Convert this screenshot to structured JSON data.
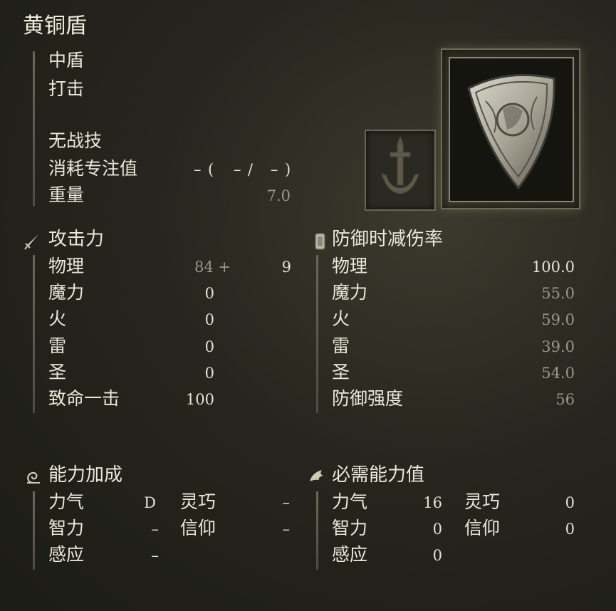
{
  "item": {
    "name": "黄铜盾",
    "type": "中盾",
    "attack_type": "打击",
    "skill": "无战技",
    "fp_label": "消耗专注值",
    "fp_dash1": "–",
    "fp_paren_open": "(",
    "fp_dash2": "–",
    "fp_slash": "/",
    "fp_dash3": "–",
    "fp_paren_close": ")",
    "weight_label": "重量",
    "weight_value": "7.0"
  },
  "attack": {
    "header": "攻击力",
    "rows": [
      {
        "label": "物理",
        "value": "84 +",
        "bonus": "9"
      },
      {
        "label": "魔力",
        "value": "0"
      },
      {
        "label": "火",
        "value": "0"
      },
      {
        "label": "雷",
        "value": "0"
      },
      {
        "label": "圣",
        "value": "0"
      },
      {
        "label": "致命一击",
        "value": "100"
      }
    ]
  },
  "defense": {
    "header": "防御时减伤率",
    "rows": [
      {
        "label": "物理",
        "value": "100.0"
      },
      {
        "label": "魔力",
        "value": "55.0"
      },
      {
        "label": "火",
        "value": "59.0"
      },
      {
        "label": "雷",
        "value": "39.0"
      },
      {
        "label": "圣",
        "value": "54.0"
      },
      {
        "label": "防御强度",
        "value": "56"
      }
    ]
  },
  "scaling": {
    "header": "能力加成",
    "str_label": "力气",
    "str_value": "D",
    "dex_label": "灵巧",
    "dex_value": "–",
    "int_label": "智力",
    "int_value": "–",
    "fai_label": "信仰",
    "fai_value": "–",
    "arc_label": "感应",
    "arc_value": "–"
  },
  "requirements": {
    "header": "必需能力值",
    "str_label": "力气",
    "str_value": "16",
    "dex_label": "灵巧",
    "dex_value": "0",
    "int_label": "智力",
    "int_value": "0",
    "fai_label": "信仰",
    "fai_value": "0",
    "arc_label": "感应",
    "arc_value": "0"
  },
  "icons": {
    "attack": "sword-icon",
    "defense": "shield-guard-icon",
    "scaling": "scaling-swirl-icon",
    "requirements": "requirements-wing-icon",
    "item_image": "brass-shield-image",
    "affinity": "sword-anchor-icon"
  }
}
